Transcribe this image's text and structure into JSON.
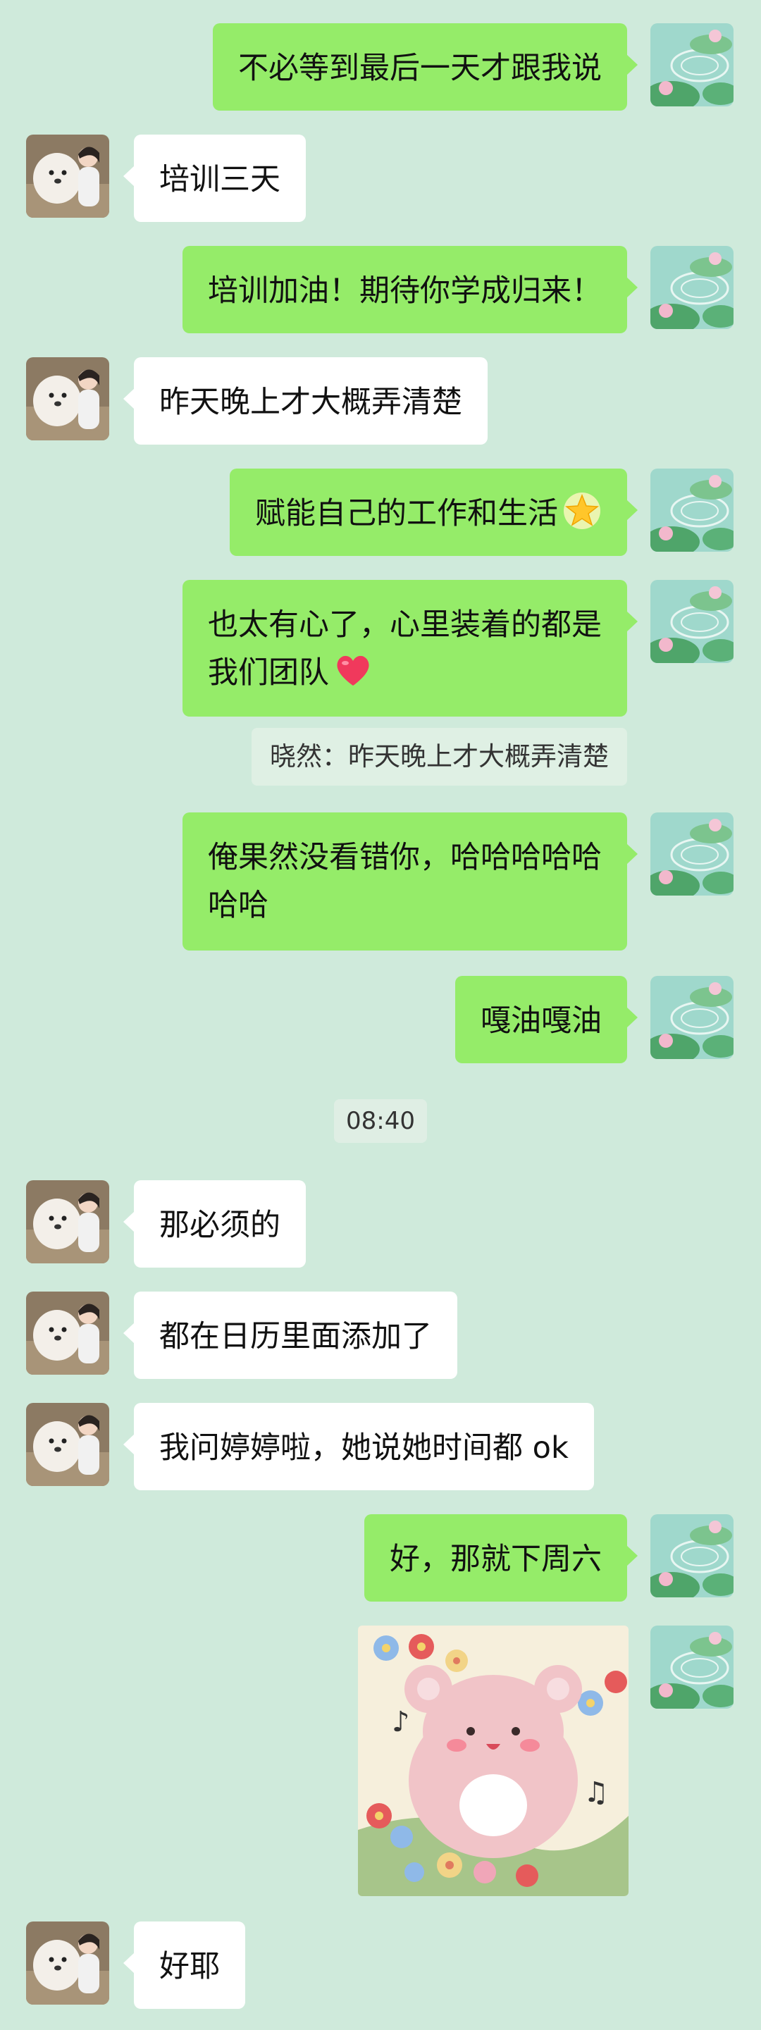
{
  "messages": {
    "m1": "不必等到最后一天才跟我说",
    "m2": "培训三天",
    "m3": "培训加油！期待你学成归来！",
    "m4": "昨天晚上才大概弄清楚",
    "m5": "赋能自己的工作和生活",
    "m6": "也太有心了，心里装着的都是\n我们团队",
    "quote": "晓然：昨天晚上才大概弄清楚",
    "m7": "俺果然没看错你，哈哈哈哈哈\n哈哈",
    "m8": "嘎油嘎油",
    "m9": "那必须的",
    "m10": "都在日历里面添加了",
    "m11": "我问婷婷啦，她说她时间都 ok",
    "m12": "好，那就下周六",
    "m13": "好耶"
  },
  "timestamp": "08:40",
  "icons": {
    "star": "star-emoji",
    "heart": "red-heart-emoji",
    "sticker": "pink-bear-flowers-sticker"
  },
  "colors": {
    "background": "#cfeadb",
    "outgoing_bubble": "#95ec69",
    "incoming_bubble": "#ffffff"
  }
}
